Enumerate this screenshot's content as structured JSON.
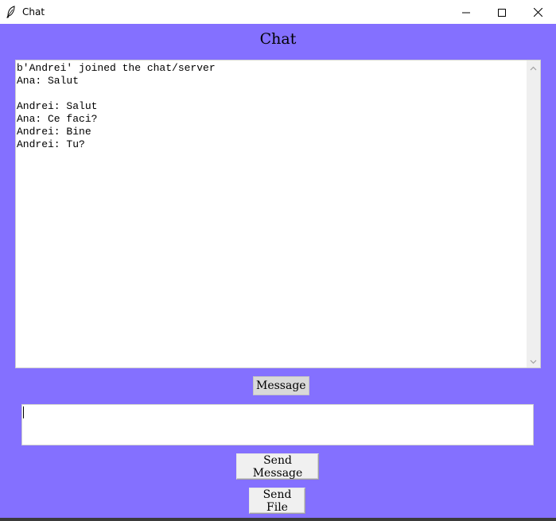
{
  "window": {
    "title": "Chat",
    "icon": "feather-icon",
    "controls": [
      "minimize-icon",
      "maximize-icon",
      "close-icon"
    ]
  },
  "header": {
    "title": "Chat"
  },
  "chat": {
    "log": "b'Andrei' joined the chat/server\nAna: Salut\n\nAndrei: Salut\nAna: Ce faci?\nAndrei: Bine\nAndrei: Tu?"
  },
  "compose": {
    "label": "Message",
    "value": ""
  },
  "actions": {
    "send_message": "Send Message",
    "send_file": "Send File"
  },
  "colors": {
    "background": "#8470ff",
    "titlebar": "#ffffff",
    "button": "#f0f0f0",
    "label": "#d9d9d9"
  }
}
